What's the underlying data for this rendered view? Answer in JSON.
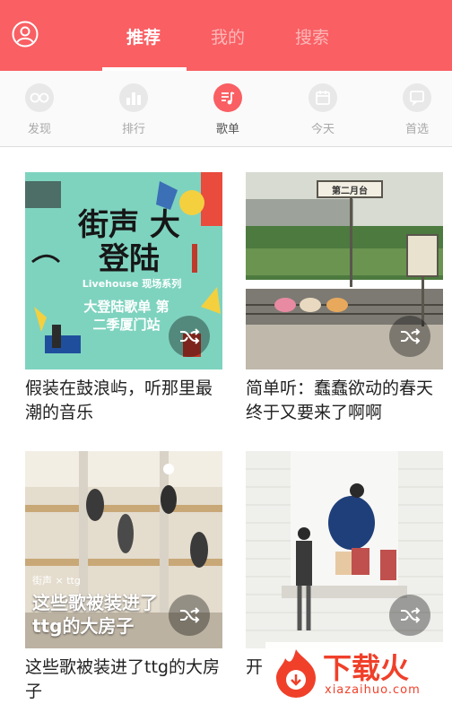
{
  "header": {
    "tabs": [
      {
        "label": "推荐",
        "active": true
      },
      {
        "label": "我的",
        "active": false
      },
      {
        "label": "搜索",
        "active": false
      }
    ],
    "accent": "#f95f63"
  },
  "subnav": {
    "items": [
      {
        "label": "发现",
        "icon": "glasses-icon"
      },
      {
        "label": "排行",
        "icon": "bar-chart-icon"
      },
      {
        "label": "歌单",
        "icon": "music-list-icon",
        "active": true
      },
      {
        "label": "今天",
        "icon": "calendar-icon"
      },
      {
        "label": "首选",
        "icon": "chat-bubble-icon"
      }
    ]
  },
  "cards": [
    {
      "title": "假装在鼓浪屿，听那里最潮的音乐",
      "cover": {
        "headline": "街声 大登陆",
        "sub": "Livehouse 现场系列",
        "caption": "大登陆歌单 第二季厦门站"
      }
    },
    {
      "title": "简单听：蠢蠢欲动的春天终于又要来了啊啊",
      "cover": {
        "sign": "第二月台"
      }
    },
    {
      "title": "这些歌被装进了ttg的大房子",
      "cover": {
        "brand": "街声 × ttg",
        "caption": "这些歌被装进了 ttg的大房子"
      }
    },
    {
      "title": "开",
      "cover": {}
    }
  ],
  "watermark": {
    "text": "下载火",
    "url": "xiazaihuo.com"
  }
}
